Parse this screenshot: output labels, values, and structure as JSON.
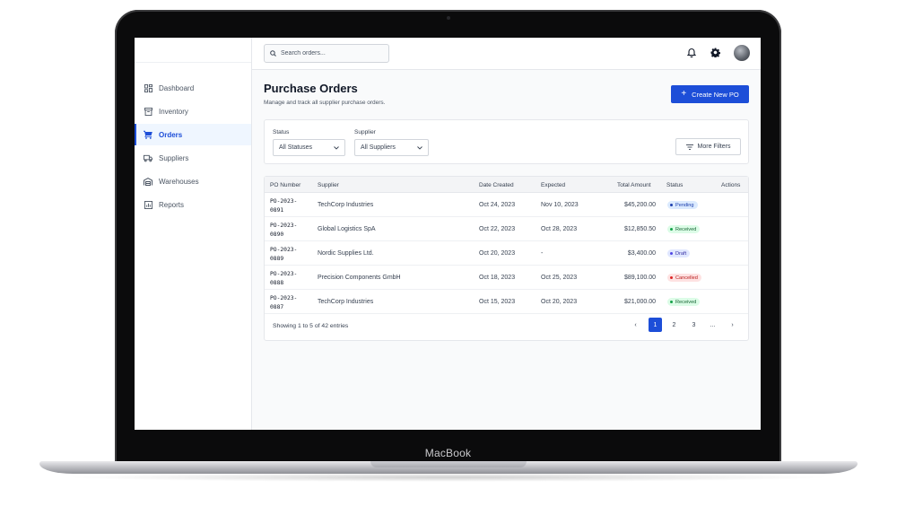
{
  "device": {
    "brand_label": "MacBook"
  },
  "sidebar": {
    "items": [
      {
        "label": "Dashboard",
        "icon": "dashboard-icon",
        "active": false
      },
      {
        "label": "Inventory",
        "icon": "inventory-icon",
        "active": false
      },
      {
        "label": "Orders",
        "icon": "cart-icon",
        "active": true
      },
      {
        "label": "Suppliers",
        "icon": "truck-icon",
        "active": false
      },
      {
        "label": "Warehouses",
        "icon": "warehouse-icon",
        "active": false
      },
      {
        "label": "Reports",
        "icon": "reports-icon",
        "active": false
      }
    ]
  },
  "topbar": {
    "search_placeholder": "Search orders...",
    "icons": [
      "bell-icon",
      "gear-icon",
      "avatar"
    ]
  },
  "page": {
    "title": "Purchase Orders",
    "subtitle": "Manage and track all supplier purchase orders.",
    "create_button": "Create New PO"
  },
  "filters": {
    "status_label": "Status",
    "status_value": "All Statuses",
    "supplier_label": "Supplier",
    "supplier_value": "All Suppliers",
    "more_filters": "More Filters"
  },
  "table": {
    "headers": [
      "PO Number",
      "Supplier",
      "Date Created",
      "Expected",
      "Total Amount",
      "Status",
      "Actions"
    ],
    "rows": [
      {
        "po_line1": "PO-2023-",
        "po_line2": "0891",
        "supplier": "TechCorp Industries",
        "created": "Oct 24, 2023",
        "expected": "Nov 10, 2023",
        "amount": "$45,200.00",
        "status": "Pending"
      },
      {
        "po_line1": "PO-2023-",
        "po_line2": "0890",
        "supplier": "Global Logistics SpA",
        "created": "Oct 22, 2023",
        "expected": "Oct 28, 2023",
        "amount": "$12,850.50",
        "status": "Received"
      },
      {
        "po_line1": "PO-2023-",
        "po_line2": "0889",
        "supplier": "Nordic Supplies Ltd.",
        "created": "Oct 20, 2023",
        "expected": "-",
        "amount": "$3,400.00",
        "status": "Draft"
      },
      {
        "po_line1": "PO-2023-",
        "po_line2": "0888",
        "supplier": "Precision Components GmbH",
        "created": "Oct 18, 2023",
        "expected": "Oct 25, 2023",
        "amount": "$89,100.00",
        "status": "Cancelled"
      },
      {
        "po_line1": "PO-2023-",
        "po_line2": "0887",
        "supplier": "TechCorp Industries",
        "created": "Oct 15, 2023",
        "expected": "Oct 20, 2023",
        "amount": "$21,000.00",
        "status": "Received"
      }
    ],
    "footer_info": "Showing 1 to 5 of 42 entries",
    "pagination": {
      "prev": "‹",
      "pages": [
        "1",
        "2",
        "3",
        "..."
      ],
      "current": "1",
      "next": "›"
    }
  },
  "colors": {
    "accent": "#1d4ed8",
    "pending": "#1e40af",
    "received": "#16a34a",
    "draft": "#4f46e5",
    "cancelled": "#dc2626"
  }
}
